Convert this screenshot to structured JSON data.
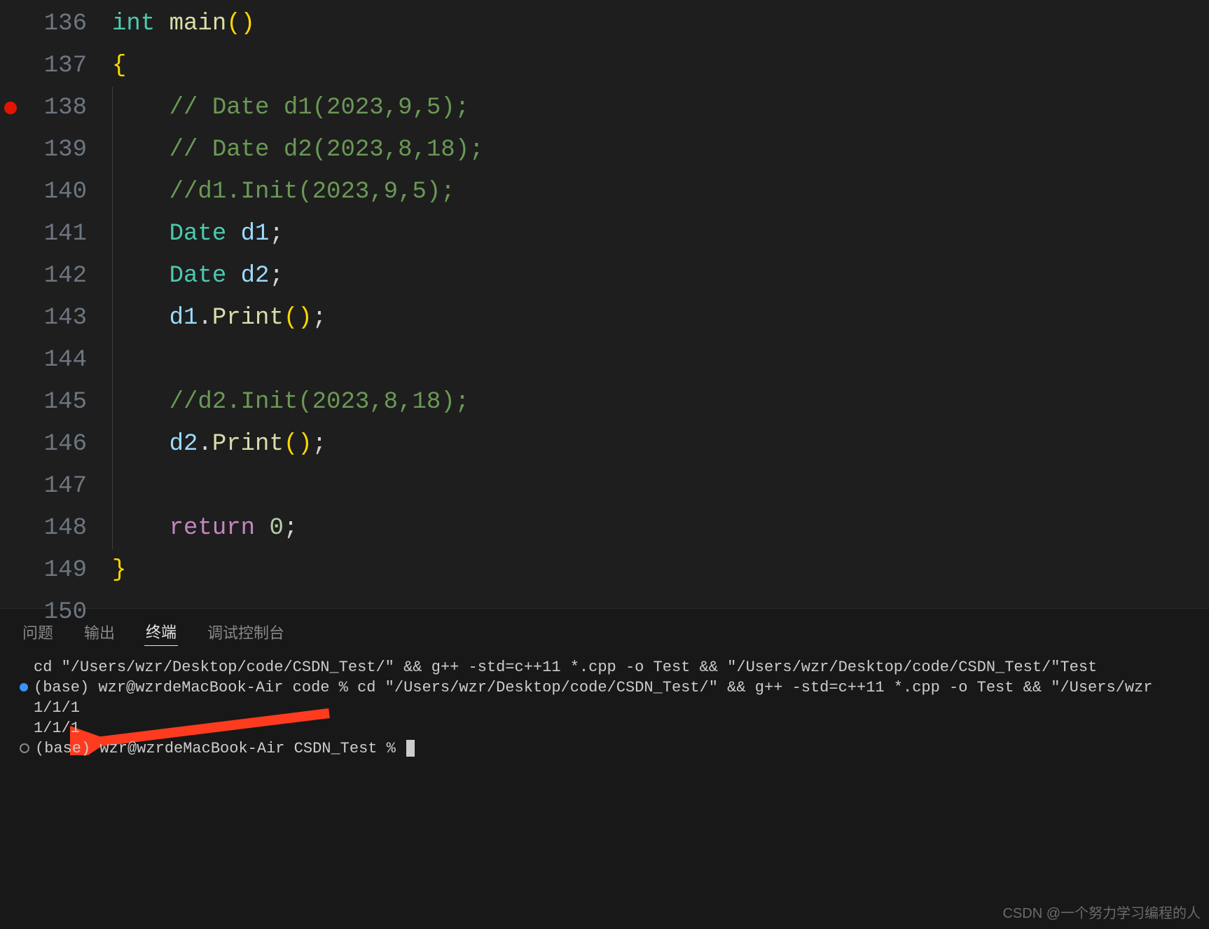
{
  "editor": {
    "lines": [
      {
        "num": "136",
        "html": "<span class='tok-type'>int</span> <span class='tok-func'>main</span><span class='tok-brace'>()</span>"
      },
      {
        "num": "137",
        "html": "<span class='tok-brace'>{</span>"
      },
      {
        "num": "138",
        "html": "    <span class='tok-cmt'>// Date d1(2023,9,5);</span>",
        "breakpoint": true,
        "guide": true
      },
      {
        "num": "139",
        "html": "    <span class='tok-cmt'>// Date d2(2023,8,18);</span>",
        "guide": true
      },
      {
        "num": "140",
        "html": "    <span class='tok-cmt'>//d1.Init(2023,9,5);</span>",
        "guide": true
      },
      {
        "num": "141",
        "html": "    <span class='tok-cls'>Date</span> <span class='tok-var'>d1</span>;",
        "guide": true
      },
      {
        "num": "142",
        "html": "    <span class='tok-cls'>Date</span> <span class='tok-var'>d2</span>;",
        "guide": true
      },
      {
        "num": "143",
        "html": "    <span class='tok-var'>d1</span>.<span class='tok-func'>Print</span><span class='tok-brace'>()</span>;",
        "guide": true
      },
      {
        "num": "144",
        "html": "",
        "guide": true
      },
      {
        "num": "145",
        "html": "    <span class='tok-cmt'>//d2.Init(2023,8,18);</span>",
        "guide": true
      },
      {
        "num": "146",
        "html": "    <span class='tok-var'>d2</span>.<span class='tok-func'>Print</span><span class='tok-brace'>()</span>;",
        "guide": true
      },
      {
        "num": "147",
        "html": "",
        "guide": true
      },
      {
        "num": "148",
        "html": "    <span class='tok-kw'>return</span> <span class='tok-num'>0</span>;",
        "guide": true
      },
      {
        "num": "149",
        "html": "<span class='tok-brace'>}</span>"
      },
      {
        "num": "150",
        "html": ""
      }
    ]
  },
  "panel": {
    "tabs": {
      "problems": "问题",
      "output": "输出",
      "terminal": "终端",
      "debug_console": "调试控制台",
      "active": "terminal"
    },
    "terminal": {
      "lines": [
        {
          "text": "cd \"/Users/wzr/Desktop/code/CSDN_Test/\" && g++ -std=c++11 *.cpp -o Test && \"/Users/wzr/Desktop/code/CSDN_Test/\"Test"
        },
        {
          "bullet": "blue",
          "text": "(base) wzr@wzrdeMacBook-Air code % cd \"/Users/wzr/Desktop/code/CSDN_Test/\" && g++ -std=c++11 *.cpp -o Test && \"/Users/wzr"
        },
        {
          "text": "1/1/1"
        },
        {
          "text": "1/1/1"
        },
        {
          "bullet": "open",
          "text": "(base) wzr@wzrdeMacBook-Air CSDN_Test % ",
          "cursor": true
        }
      ]
    }
  },
  "watermark": "CSDN @一个努力学习编程的人"
}
